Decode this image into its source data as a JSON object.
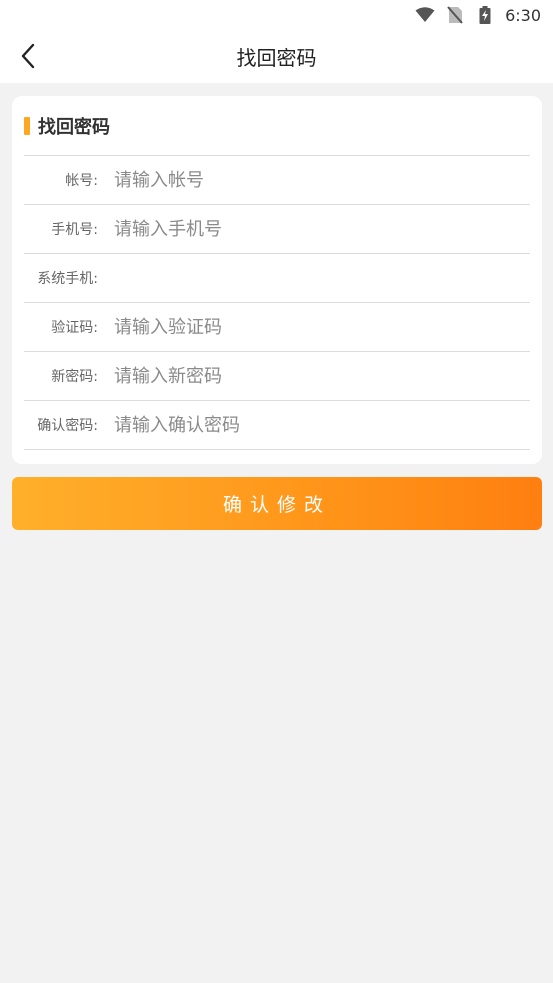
{
  "status_bar": {
    "time": "6:30",
    "icons": [
      "wifi-icon",
      "no-sim-icon",
      "battery-charging-icon"
    ]
  },
  "nav": {
    "title": "找回密码",
    "back_icon": "chevron-left-icon"
  },
  "card": {
    "title": "找回密码",
    "accent_color": "#ffa722"
  },
  "form": {
    "account": {
      "label": "帐号:",
      "placeholder": "请输入帐号",
      "value": ""
    },
    "phone": {
      "label": "手机号:",
      "placeholder": "请输入手机号",
      "value": ""
    },
    "system_phone": {
      "label": "系统手机:",
      "value": ""
    },
    "code": {
      "label": "验证码:",
      "placeholder": "请输入验证码",
      "value": ""
    },
    "new_password": {
      "label": "新密码:",
      "placeholder": "请输入新密码",
      "value": ""
    },
    "confirm_password": {
      "label": "确认密码:",
      "placeholder": "请输入确认密码",
      "value": ""
    }
  },
  "confirm_button": {
    "label": "确认修改",
    "gradient_start": "#ffb02b",
    "gradient_end": "#ff7f10"
  }
}
